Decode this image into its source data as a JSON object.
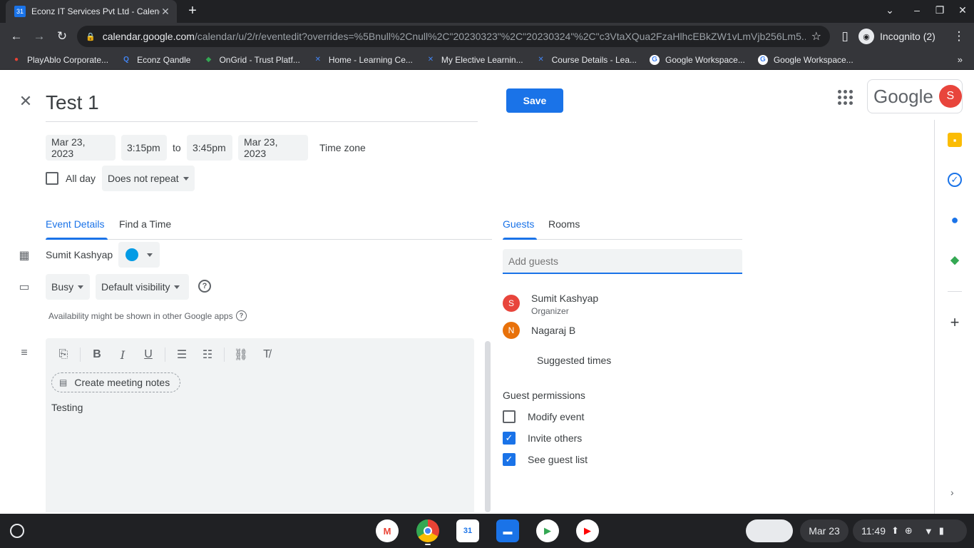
{
  "browser": {
    "tab_title": "Econz IT Services Pvt Ltd - Calendar",
    "tab_favicon": "31",
    "url_host": "calendar.google.com",
    "url_path": "/calendar/u/2/r/eventedit?overrides=%5Bnull%2Cnull%2C\"20230323\"%2C\"20230324\"%2C\"c3VtaXQua2FzaHlhcEBkZW1vLmVjb256Lm5...",
    "profile_label": "Incognito (2)",
    "bookmarks": [
      {
        "label": "PlayAblo Corporate...",
        "icon": "pin-icon",
        "color": "#ea4335"
      },
      {
        "label": "Econz Qandle",
        "icon": "q-icon",
        "color": "#4285f4"
      },
      {
        "label": "OnGrid - Trust Platf...",
        "icon": "box-icon",
        "color": "#34a853"
      },
      {
        "label": "Home - Learning Ce...",
        "icon": "x-icon",
        "color": "#4285f4"
      },
      {
        "label": "My Elective Learnin...",
        "icon": "x-icon",
        "color": "#4285f4"
      },
      {
        "label": "Course Details - Lea...",
        "icon": "x-icon",
        "color": "#4285f4"
      },
      {
        "label": "Google Workspace...",
        "icon": "google-icon",
        "color": "#ffffff"
      },
      {
        "label": "Google Workspace...",
        "icon": "google-icon",
        "color": "#ffffff"
      }
    ]
  },
  "event": {
    "title": "Test 1",
    "save_label": "Save",
    "start_date": "Mar 23, 2023",
    "start_time": "3:15pm",
    "to_label": "to",
    "end_time": "3:45pm",
    "end_date": "Mar 23, 2023",
    "timezone_label": "Time zone",
    "all_day_label": "All day",
    "repeat_label": "Does not repeat",
    "tabs": {
      "details": "Event Details",
      "find_time": "Find a Time"
    },
    "calendar_owner": "Sumit Kashyap",
    "calendar_color": "#039be5",
    "busy_label": "Busy",
    "visibility_label": "Default visibility",
    "availability_note": "Availability might be shown in other Google apps",
    "meeting_notes_label": "Create meeting notes",
    "description": "Testing"
  },
  "guests": {
    "tabs": {
      "guests": "Guests",
      "rooms": "Rooms"
    },
    "add_placeholder": "Add guests",
    "list": [
      {
        "initial": "S",
        "name": "Sumit Kashyap",
        "role": "Organizer",
        "color": "#e8453c"
      },
      {
        "initial": "N",
        "name": "Nagaraj B",
        "color": "#e8710a"
      }
    ],
    "suggested_times": "Suggested times",
    "permissions_title": "Guest permissions",
    "permissions": [
      {
        "label": "Modify event",
        "checked": false
      },
      {
        "label": "Invite others",
        "checked": true
      },
      {
        "label": "See guest list",
        "checked": true
      }
    ]
  },
  "account": {
    "google_word": "Google",
    "avatar_initial": "S"
  },
  "shelf": {
    "date": "Mar 23",
    "time": "11:49"
  }
}
